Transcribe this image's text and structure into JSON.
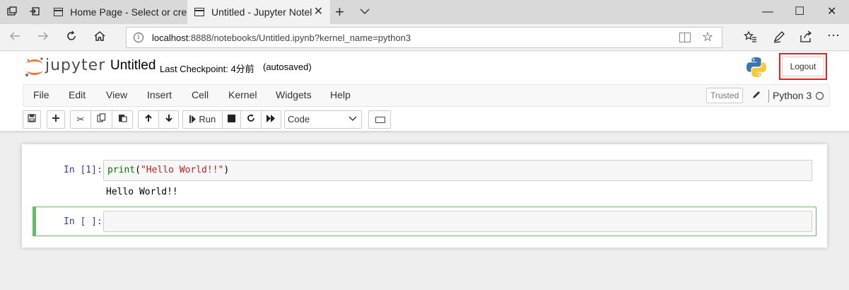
{
  "browser": {
    "tabs": [
      {
        "title": "Home Page - Select or creat",
        "active": false
      },
      {
        "title": "Untitled - Jupyter Notel",
        "active": true
      }
    ],
    "new_tab": "+",
    "url_host": "localhost",
    "url_rest": ":8888/notebooks/Untitled.ipynb?kernel_name=python3",
    "window_controls": {
      "minimize": "—",
      "maximize": "☐",
      "close": "✕"
    }
  },
  "jupyter": {
    "logo_text": "jupyter",
    "notebook_name": "Untitled",
    "checkpoint": "Last Checkpoint: 4分前",
    "autosaved": "(autosaved)",
    "logout_label": "Logout",
    "menu": [
      "File",
      "Edit",
      "View",
      "Insert",
      "Cell",
      "Kernel",
      "Widgets",
      "Help"
    ],
    "trusted_label": "Trusted",
    "kernel_name": "Python 3",
    "toolbar": {
      "run_label": "Run",
      "cell_type": "Code"
    }
  },
  "cells": [
    {
      "prompt": "In [1]:",
      "code": {
        "fn": "print",
        "open": "(",
        "str": "\"Hello World!!\"",
        "close": ")"
      },
      "output": "Hello World!!"
    },
    {
      "prompt": "In [ ]:",
      "code": ""
    }
  ],
  "colors": {
    "prompt_blue": "#303f9f",
    "selected_green": "#66bb6a",
    "logout_highlight": "#e0201a",
    "jupyter_orange": "#f37726"
  }
}
